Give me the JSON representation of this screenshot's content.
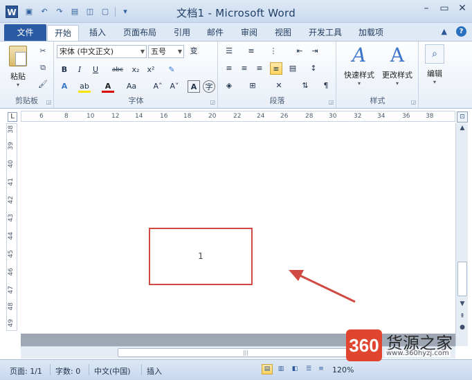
{
  "titlebar": {
    "app_letter": "W",
    "title": "文档1 - Microsoft Word"
  },
  "tabs": {
    "file": "文件",
    "items": [
      "开始",
      "插入",
      "页面布局",
      "引用",
      "邮件",
      "审阅",
      "视图",
      "开发工具",
      "加载项"
    ]
  },
  "ribbon": {
    "clipboard": {
      "label": "剪贴板",
      "paste": "粘贴"
    },
    "font": {
      "label": "字体",
      "font_name": "宋体 (中文正文)",
      "font_size": "五号",
      "wen": "变",
      "grow": "A˄",
      "shrink": "A˅",
      "aa": "Aa",
      "char_border": "A",
      "char_circle": "字"
    },
    "paragraph": {
      "label": "段落"
    },
    "styles": {
      "label": "样式",
      "quick_styles": "快速样式",
      "change_styles": "更改样式"
    },
    "editing": {
      "label": "编辑"
    }
  },
  "hruler_ticks": [
    "6",
    "8",
    "10",
    "12",
    "14",
    "16",
    "18",
    "20",
    "22",
    "24",
    "26",
    "28",
    "30",
    "32",
    "34",
    "36",
    "38"
  ],
  "vruler_ticks": [
    "38",
    "39",
    "40",
    "41",
    "42",
    "43",
    "44",
    "45",
    "46",
    "47",
    "48",
    "49"
  ],
  "document": {
    "page_number": "1"
  },
  "statusbar": {
    "page": "页面: 1/1",
    "words": "字数: 0",
    "lang": "中文(中国)",
    "insert": "插入",
    "zoom": "120%"
  },
  "watermark": {
    "logo": "360",
    "brand": "货源之家",
    "url": "www.360hyzj.com"
  },
  "colors": {
    "file_tab": "#2a5aa3",
    "highlight_box": "#d04a43",
    "arrow": "#d04a43"
  }
}
